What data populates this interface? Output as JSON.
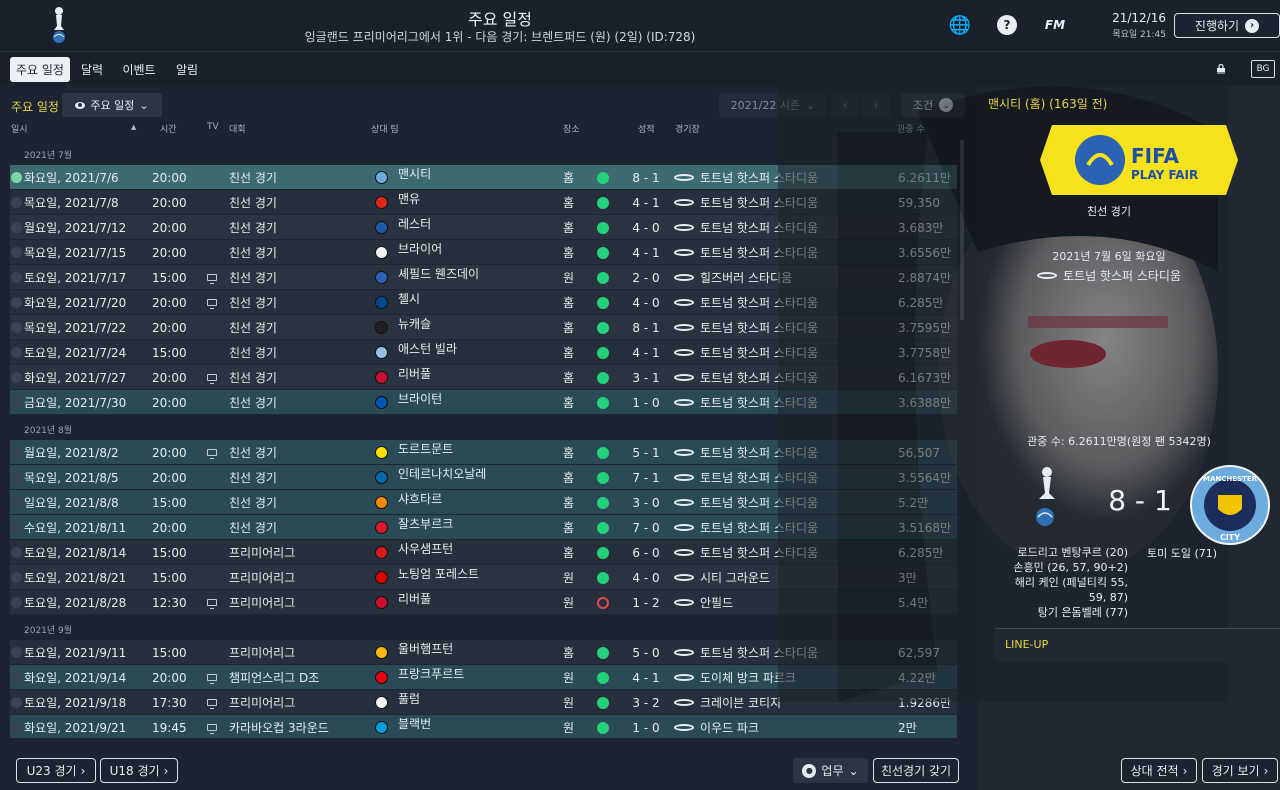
{
  "header": {
    "title": "주요 일정",
    "subtitle": "잉글랜드 프리미어리그에서 1위 - 다음 경기: 브렌트퍼드 (원) (2일) (ID:728)",
    "fm_label": "FM",
    "help_label": "?",
    "date": "21/12/16",
    "day_time": "목요일 21:45",
    "continue_label": "진행하기"
  },
  "tabs": [
    "주요 일정",
    "달력",
    "이벤트",
    "알림"
  ],
  "toolbar": {
    "section_title": "주요 일정",
    "view_label": "주요 일정",
    "season_label": "2021/22 시즌",
    "filter_label": "조건",
    "bg_label": "BG"
  },
  "columns": {
    "date": "일시",
    "time": "시간",
    "tv": "TV",
    "comp": "대회",
    "opp": "상대 팀",
    "venue": "장소",
    "result": "성적",
    "stadium": "경기장",
    "att": "관중 수"
  },
  "fixtures": [
    {
      "group": "2021년 7월"
    },
    {
      "date": "화요일, 2021/7/6",
      "time": "20:00",
      "tv": false,
      "comp": "친선 경기",
      "opp": "맨시티",
      "badge": "#6cabdd",
      "venue": "홈",
      "res": "W",
      "score": "8 - 1",
      "stadium": "토트넘 핫스퍼 스타디움",
      "att": "6.2611만",
      "style": "sel"
    },
    {
      "date": "목요일, 2021/7/8",
      "time": "20:00",
      "tv": false,
      "comp": "친선 경기",
      "opp": "맨유",
      "badge": "#da291c",
      "venue": "홈",
      "res": "W",
      "score": "4 - 1",
      "stadium": "토트넘 핫스퍼 스타디움",
      "att": "59,350",
      "style": ""
    },
    {
      "date": "월요일, 2021/7/12",
      "time": "20:00",
      "tv": false,
      "comp": "친선 경기",
      "opp": "레스터",
      "badge": "#1d5ba4",
      "venue": "홈",
      "res": "W",
      "score": "4 - 0",
      "stadium": "토트넘 핫스퍼 스타디움",
      "att": "3.683만",
      "style": "alt"
    },
    {
      "date": "목요일, 2021/7/15",
      "time": "20:00",
      "tv": false,
      "comp": "친선 경기",
      "opp": "브라이어",
      "badge": "#f2f2f2",
      "venue": "홈",
      "res": "W",
      "score": "4 - 1",
      "stadium": "토트넘 핫스퍼 스타디움",
      "att": "3.6556만",
      "style": ""
    },
    {
      "date": "토요일, 2021/7/17",
      "time": "15:00",
      "tv": true,
      "comp": "친선 경기",
      "opp": "셰필드 웬즈데이",
      "badge": "#2c63b5",
      "venue": "원",
      "res": "W",
      "score": "2 - 0",
      "stadium": "힐즈버러 스타디움",
      "att": "2.8874만",
      "style": "alt"
    },
    {
      "date": "화요일, 2021/7/20",
      "time": "20:00",
      "tv": true,
      "comp": "친선 경기",
      "opp": "첼시",
      "badge": "#034694",
      "venue": "홈",
      "res": "W",
      "score": "4 - 0",
      "stadium": "토트넘 핫스퍼 스타디움",
      "att": "6.285만",
      "style": ""
    },
    {
      "date": "목요일, 2021/7/22",
      "time": "20:00",
      "tv": false,
      "comp": "친선 경기",
      "opp": "뉴캐슬",
      "badge": "#241f20",
      "venue": "홈",
      "res": "W",
      "score": "8 - 1",
      "stadium": "토트넘 핫스퍼 스타디움",
      "att": "3.7595만",
      "style": "alt"
    },
    {
      "date": "토요일, 2021/7/24",
      "time": "15:00",
      "tv": false,
      "comp": "친선 경기",
      "opp": "애스턴 빌라",
      "badge": "#95bfe5",
      "venue": "홈",
      "res": "W",
      "score": "4 - 1",
      "stadium": "토트넘 핫스퍼 스타디움",
      "att": "3.7758만",
      "style": ""
    },
    {
      "date": "화요일, 2021/7/27",
      "time": "20:00",
      "tv": true,
      "comp": "친선 경기",
      "opp": "리버풀",
      "badge": "#c8102e",
      "venue": "홈",
      "res": "W",
      "score": "3 - 1",
      "stadium": "토트넘 핫스퍼 스타디움",
      "att": "6.1673만",
      "style": "alt"
    },
    {
      "date": "금요일, 2021/7/30",
      "time": "20:00",
      "tv": false,
      "comp": "친선 경기",
      "opp": "브라이턴",
      "badge": "#0057b8",
      "venue": "홈",
      "res": "W",
      "score": "1 - 0",
      "stadium": "토트넘 핫스퍼 스타디움",
      "att": "3.6388만",
      "style": "hl"
    },
    {
      "group": "2021년 8월"
    },
    {
      "date": "월요일, 2021/8/2",
      "time": "20:00",
      "tv": true,
      "comp": "친선 경기",
      "opp": "도르트문트",
      "badge": "#fde100",
      "venue": "홈",
      "res": "W",
      "score": "5 - 1",
      "stadium": "토트넘 핫스퍼 스타디움",
      "att": "56,507",
      "style": "hl"
    },
    {
      "date": "목요일, 2021/8/5",
      "time": "20:00",
      "tv": false,
      "comp": "친선 경기",
      "opp": "인테르나치오날레",
      "badge": "#0068a8",
      "venue": "홈",
      "res": "W",
      "score": "7 - 1",
      "stadium": "토트넘 핫스퍼 스타디움",
      "att": "3.5564만",
      "style": "hl"
    },
    {
      "date": "일요일, 2021/8/8",
      "time": "15:00",
      "tv": false,
      "comp": "친선 경기",
      "opp": "샤흐타르",
      "badge": "#f18a00",
      "venue": "홈",
      "res": "W",
      "score": "3 - 0",
      "stadium": "토트넘 핫스퍼 스타디움",
      "att": "5.2만",
      "style": "hl"
    },
    {
      "date": "수요일, 2021/8/11",
      "time": "20:00",
      "tv": false,
      "comp": "친선 경기",
      "opp": "잘츠부르크",
      "badge": "#d7182a",
      "venue": "홈",
      "res": "W",
      "score": "7 - 0",
      "stadium": "토트넘 핫스퍼 스타디움",
      "att": "3.5168만",
      "style": "hl"
    },
    {
      "date": "토요일, 2021/8/14",
      "time": "15:00",
      "tv": false,
      "comp": "프리미어리그",
      "opp": "사우샘프턴",
      "badge": "#d71920",
      "venue": "홈",
      "res": "W",
      "score": "6 - 0",
      "stadium": "토트넘 핫스퍼 스타디움",
      "att": "6.285만",
      "style": ""
    },
    {
      "date": "토요일, 2021/8/21",
      "time": "15:00",
      "tv": false,
      "comp": "프리미어리그",
      "opp": "노팅엄 포레스트",
      "badge": "#dd0000",
      "venue": "원",
      "res": "W",
      "score": "4 - 0",
      "stadium": "시티 그라운드",
      "att": "3만",
      "style": "alt"
    },
    {
      "date": "토요일, 2021/8/28",
      "time": "12:30",
      "tv": true,
      "comp": "프리미어리그",
      "opp": "리버풀",
      "badge": "#c8102e",
      "venue": "원",
      "res": "L",
      "score": "1 - 2",
      "stadium": "안필드",
      "att": "5.4만",
      "style": ""
    },
    {
      "group": "2021년 9월"
    },
    {
      "date": "토요일, 2021/9/11",
      "time": "15:00",
      "tv": false,
      "comp": "프리미어리그",
      "opp": "울버햄프턴",
      "badge": "#fdb913",
      "venue": "홈",
      "res": "W",
      "score": "5 - 0",
      "stadium": "토트넘 핫스퍼 스타디움",
      "att": "62,597",
      "style": ""
    },
    {
      "date": "화요일, 2021/9/14",
      "time": "20:00",
      "tv": true,
      "comp": "챔피언스리그 D조",
      "opp": "프랑크푸르트",
      "badge": "#e1000f",
      "venue": "원",
      "res": "W",
      "score": "4 - 1",
      "stadium": "도이체 방크 파르크",
      "att": "4.22만",
      "style": "hl"
    },
    {
      "date": "토요일, 2021/9/18",
      "time": "17:30",
      "tv": true,
      "comp": "프리미어리그",
      "opp": "풀럼",
      "badge": "#f5f5f5",
      "venue": "원",
      "res": "W",
      "score": "3 - 2",
      "stadium": "크레이븐 코티지",
      "att": "1.9286만",
      "style": ""
    },
    {
      "date": "화요일, 2021/9/21",
      "time": "19:45",
      "tv": true,
      "comp": "카라바오컵 3라운드",
      "opp": "블랙번",
      "badge": "#009ee0",
      "venue": "원",
      "res": "W",
      "score": "1 - 0",
      "stadium": "이우드 파크",
      "att": "2만",
      "style": "hl"
    }
  ],
  "bottom": {
    "u23_label": "U23 경기",
    "u18_label": "U18 경기",
    "work_label": "업무",
    "arrange_label": "친선경기 갖기"
  },
  "detail": {
    "header": "맨시티 (홈) (163일 전)",
    "fair_play_line1": "FIFA",
    "fair_play_line2": "PLAY FAIR",
    "competition": "친선 경기",
    "date": "2021년 7월 6일 화요일",
    "stadium": "토트넘 핫스퍼 스타디움",
    "attendance": "관중 수: 6.2611만명(원정 팬 5342명)",
    "score": "8 - 1",
    "away_crest_top": "MANCHESTER",
    "away_crest_bottom": "CITY",
    "home_scorers": [
      "로드리고 벤탕쿠르 (20)",
      "손흥민 (26, 57, 90+2)",
      "해리 케인 (페널티킥 55,",
      "59, 87)",
      "탕기 은돔벨레 (77)"
    ],
    "away_scorers": [
      "토미 도일 (71)"
    ],
    "lineup_label": "LINE-UP",
    "h2h_label": "상대 전적",
    "view_label": "경기 보기"
  }
}
